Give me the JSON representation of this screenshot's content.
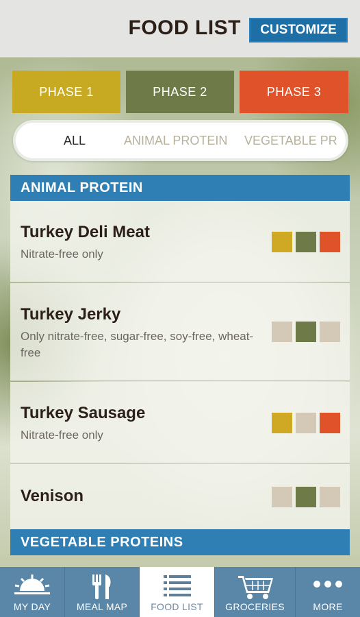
{
  "header": {
    "title": "FOOD LIST",
    "customize_label": "CUSTOMIZE"
  },
  "phases": [
    {
      "label": "PHASE 1",
      "color": "#c8a922"
    },
    {
      "label": "PHASE 2",
      "color": "#6e7a47"
    },
    {
      "label": "PHASE 3",
      "color": "#e0532a"
    }
  ],
  "filters": {
    "selected": "ALL",
    "items": [
      "ALL",
      "ANIMAL PROTEIN",
      "VEGETABLE PR"
    ]
  },
  "sections": [
    {
      "title": "ANIMAL PROTEIN",
      "items": [
        {
          "name": "Turkey Deli Meat",
          "note": "Nitrate-free only",
          "phases": [
            true,
            true,
            true
          ]
        },
        {
          "name": "Turkey Jerky",
          "note": "Only nitrate-free, sugar-free, soy-free, wheat-free",
          "phases": [
            false,
            true,
            false
          ]
        },
        {
          "name": "Turkey Sausage",
          "note": "Nitrate-free only",
          "phases": [
            true,
            false,
            true
          ]
        },
        {
          "name": "Venison",
          "note": "",
          "phases": [
            false,
            true,
            false
          ]
        }
      ]
    },
    {
      "title": "VEGETABLE PROTEINS",
      "items": []
    }
  ],
  "nav": {
    "active": "FOOD LIST",
    "items": [
      {
        "label": "MY DAY",
        "icon": "sunrise-icon"
      },
      {
        "label": "MEAL MAP",
        "icon": "fork-knife-icon"
      },
      {
        "label": "FOOD LIST",
        "icon": "list-icon"
      },
      {
        "label": "GROCERIES",
        "icon": "cart-icon"
      },
      {
        "label": "MORE",
        "icon": "more-dots-icon"
      }
    ]
  },
  "colors": {
    "accent_blue": "#2f7fb5",
    "nav_blue": "#5a87a7",
    "phase_off": "#d3c9b6"
  }
}
